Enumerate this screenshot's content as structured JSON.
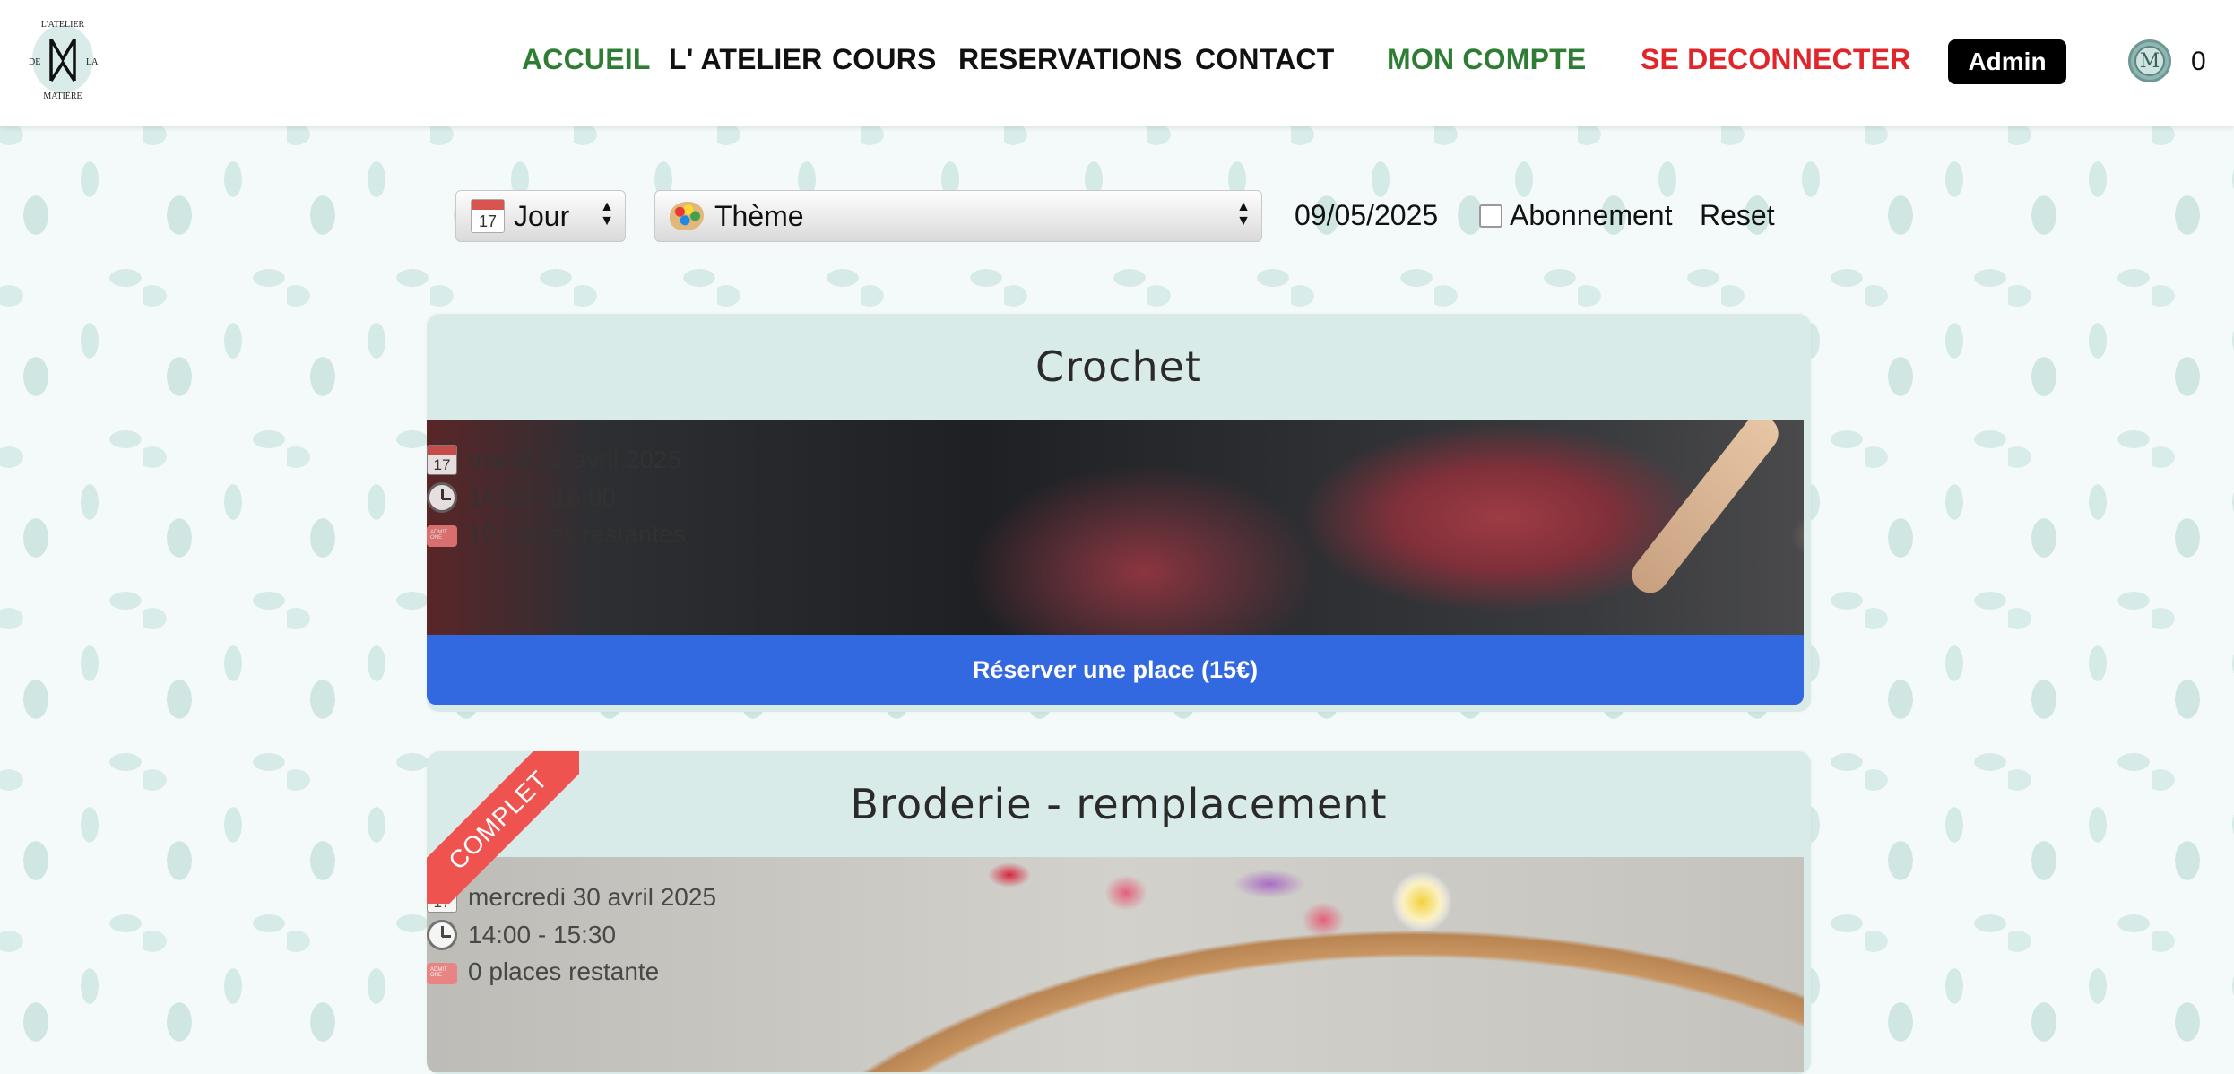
{
  "brand": {
    "logo_top": "L'ATELIER",
    "logo_left": "DE",
    "logo_right": "LA",
    "logo_bottom": "MATIÈRE"
  },
  "nav": {
    "items": [
      {
        "label": "ACCUEIL"
      },
      {
        "label": "L' ATELIER"
      },
      {
        "label": "COURS"
      },
      {
        "label": "RESERVATIONS"
      },
      {
        "label": "CONTACT"
      },
      {
        "label": "MON COMPTE"
      },
      {
        "label": "SE DECONNECTER"
      }
    ],
    "admin_label": "Admin",
    "coin_letter": "M",
    "coin_count": "0"
  },
  "filters": {
    "day_icon_text": "17",
    "day_label": "Jour",
    "theme_label": "Thème",
    "date_value": "09/05/2025",
    "abonnement_label": "Abonnement",
    "abonnement_checked": false,
    "reset_label": "Reset"
  },
  "courses": [
    {
      "title": "Crochet",
      "date": "mardi 22 avril 2025",
      "time": "14:00 - 16:00",
      "places": "10 places restantes",
      "button": "Réserver une place (15€)"
    },
    {
      "title": "Broderie - remplacement",
      "ribbon": "COMPLET",
      "date": "mercredi 30 avril 2025",
      "time": "14:00 - 15:30",
      "places": "0 places restante"
    }
  ],
  "colors": {
    "nav_green": "#2f7d34",
    "nav_red": "#e0262b",
    "button_blue": "#3369e0",
    "card_bg": "#d9ebe8",
    "ribbon_red": "#ef5350"
  }
}
